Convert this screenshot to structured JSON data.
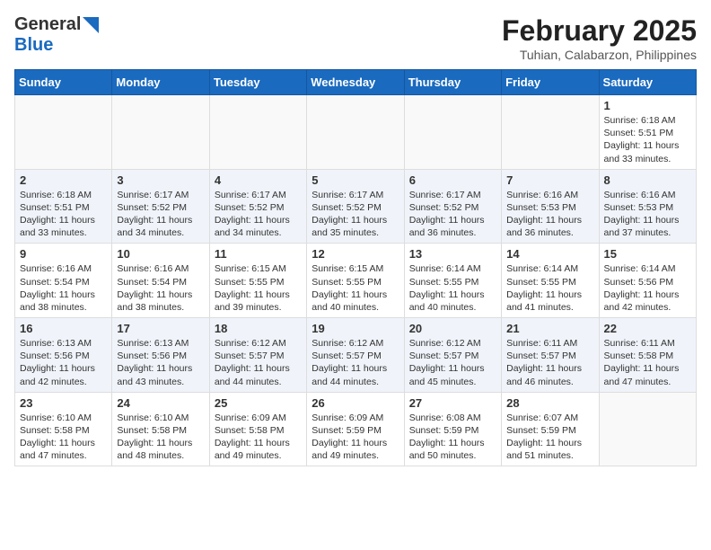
{
  "header": {
    "logo_general": "General",
    "logo_blue": "Blue",
    "month_year": "February 2025",
    "location": "Tuhian, Calabarzon, Philippines"
  },
  "days_of_week": [
    "Sunday",
    "Monday",
    "Tuesday",
    "Wednesday",
    "Thursday",
    "Friday",
    "Saturday"
  ],
  "weeks": [
    {
      "days": [
        {
          "num": "",
          "info": ""
        },
        {
          "num": "",
          "info": ""
        },
        {
          "num": "",
          "info": ""
        },
        {
          "num": "",
          "info": ""
        },
        {
          "num": "",
          "info": ""
        },
        {
          "num": "",
          "info": ""
        },
        {
          "num": "1",
          "info": "Sunrise: 6:18 AM\nSunset: 5:51 PM\nDaylight: 11 hours and 33 minutes."
        }
      ]
    },
    {
      "days": [
        {
          "num": "2",
          "info": "Sunrise: 6:18 AM\nSunset: 5:51 PM\nDaylight: 11 hours and 33 minutes."
        },
        {
          "num": "3",
          "info": "Sunrise: 6:17 AM\nSunset: 5:52 PM\nDaylight: 11 hours and 34 minutes."
        },
        {
          "num": "4",
          "info": "Sunrise: 6:17 AM\nSunset: 5:52 PM\nDaylight: 11 hours and 34 minutes."
        },
        {
          "num": "5",
          "info": "Sunrise: 6:17 AM\nSunset: 5:52 PM\nDaylight: 11 hours and 35 minutes."
        },
        {
          "num": "6",
          "info": "Sunrise: 6:17 AM\nSunset: 5:52 PM\nDaylight: 11 hours and 36 minutes."
        },
        {
          "num": "7",
          "info": "Sunrise: 6:16 AM\nSunset: 5:53 PM\nDaylight: 11 hours and 36 minutes."
        },
        {
          "num": "8",
          "info": "Sunrise: 6:16 AM\nSunset: 5:53 PM\nDaylight: 11 hours and 37 minutes."
        }
      ]
    },
    {
      "days": [
        {
          "num": "9",
          "info": "Sunrise: 6:16 AM\nSunset: 5:54 PM\nDaylight: 11 hours and 38 minutes."
        },
        {
          "num": "10",
          "info": "Sunrise: 6:16 AM\nSunset: 5:54 PM\nDaylight: 11 hours and 38 minutes."
        },
        {
          "num": "11",
          "info": "Sunrise: 6:15 AM\nSunset: 5:55 PM\nDaylight: 11 hours and 39 minutes."
        },
        {
          "num": "12",
          "info": "Sunrise: 6:15 AM\nSunset: 5:55 PM\nDaylight: 11 hours and 40 minutes."
        },
        {
          "num": "13",
          "info": "Sunrise: 6:14 AM\nSunset: 5:55 PM\nDaylight: 11 hours and 40 minutes."
        },
        {
          "num": "14",
          "info": "Sunrise: 6:14 AM\nSunset: 5:55 PM\nDaylight: 11 hours and 41 minutes."
        },
        {
          "num": "15",
          "info": "Sunrise: 6:14 AM\nSunset: 5:56 PM\nDaylight: 11 hours and 42 minutes."
        }
      ]
    },
    {
      "days": [
        {
          "num": "16",
          "info": "Sunrise: 6:13 AM\nSunset: 5:56 PM\nDaylight: 11 hours and 42 minutes."
        },
        {
          "num": "17",
          "info": "Sunrise: 6:13 AM\nSunset: 5:56 PM\nDaylight: 11 hours and 43 minutes."
        },
        {
          "num": "18",
          "info": "Sunrise: 6:12 AM\nSunset: 5:57 PM\nDaylight: 11 hours and 44 minutes."
        },
        {
          "num": "19",
          "info": "Sunrise: 6:12 AM\nSunset: 5:57 PM\nDaylight: 11 hours and 44 minutes."
        },
        {
          "num": "20",
          "info": "Sunrise: 6:12 AM\nSunset: 5:57 PM\nDaylight: 11 hours and 45 minutes."
        },
        {
          "num": "21",
          "info": "Sunrise: 6:11 AM\nSunset: 5:57 PM\nDaylight: 11 hours and 46 minutes."
        },
        {
          "num": "22",
          "info": "Sunrise: 6:11 AM\nSunset: 5:58 PM\nDaylight: 11 hours and 47 minutes."
        }
      ]
    },
    {
      "days": [
        {
          "num": "23",
          "info": "Sunrise: 6:10 AM\nSunset: 5:58 PM\nDaylight: 11 hours and 47 minutes."
        },
        {
          "num": "24",
          "info": "Sunrise: 6:10 AM\nSunset: 5:58 PM\nDaylight: 11 hours and 48 minutes."
        },
        {
          "num": "25",
          "info": "Sunrise: 6:09 AM\nSunset: 5:58 PM\nDaylight: 11 hours and 49 minutes."
        },
        {
          "num": "26",
          "info": "Sunrise: 6:09 AM\nSunset: 5:59 PM\nDaylight: 11 hours and 49 minutes."
        },
        {
          "num": "27",
          "info": "Sunrise: 6:08 AM\nSunset: 5:59 PM\nDaylight: 11 hours and 50 minutes."
        },
        {
          "num": "28",
          "info": "Sunrise: 6:07 AM\nSunset: 5:59 PM\nDaylight: 11 hours and 51 minutes."
        },
        {
          "num": "",
          "info": ""
        }
      ]
    }
  ]
}
